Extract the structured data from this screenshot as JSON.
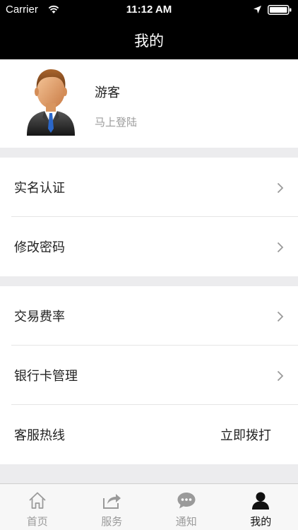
{
  "status_bar": {
    "carrier": "Carrier",
    "time": "11:12 AM"
  },
  "nav": {
    "title": "我的"
  },
  "profile": {
    "name": "游客",
    "login_link": "马上登陆"
  },
  "menu": {
    "group1": [
      {
        "label": "实名认证"
      },
      {
        "label": "修改密码"
      }
    ],
    "group2": [
      {
        "label": "交易费率"
      },
      {
        "label": "银行卡管理"
      },
      {
        "label": "客服热线",
        "action": "立即拨打"
      }
    ]
  },
  "tabs": [
    {
      "label": "首页",
      "icon": "home-icon"
    },
    {
      "label": "服务",
      "icon": "share-icon"
    },
    {
      "label": "通知",
      "icon": "chat-bubble-icon"
    },
    {
      "label": "我的",
      "icon": "person-icon",
      "active": true
    }
  ],
  "colors": {
    "bar_bg": "#000000",
    "separator": "#ececee",
    "muted_text": "#9b9b9b",
    "tab_inactive": "#9a9a9a"
  }
}
